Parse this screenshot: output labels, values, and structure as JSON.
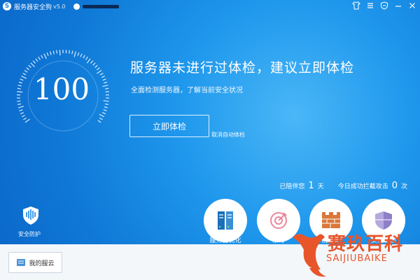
{
  "titlebar": {
    "logo_letter": "S",
    "title": "服务器安全狗",
    "version": "v5.0",
    "controls": {
      "skin": "shirt-icon",
      "menu": "menu-icon",
      "feedback": "shield-icon",
      "minimize": "minimize-icon",
      "close": "close-icon"
    }
  },
  "gauge": {
    "score": "100"
  },
  "main": {
    "headline": "服务器未进行过体检，建议立即体检",
    "subline": "全面检测服务器，了解当前安全状况",
    "primary_button": "立即体检",
    "cancel_link": "取消自动体检"
  },
  "stats": {
    "accompany_prefix": "已陪伴您",
    "accompany_days": "1",
    "accompany_unit": "天",
    "blocked_prefix": "今日成功拦截攻击",
    "blocked_count": "0",
    "blocked_unit": "次"
  },
  "protect": {
    "label": "安全防护",
    "icon": "shield-pulse-icon"
  },
  "tiles": [
    {
      "label": "服务器优化",
      "icon": "server-icon"
    },
    {
      "label": "杀毒",
      "icon": "target-icon"
    },
    {
      "label": "防火墙",
      "icon": "firewall-icon"
    },
    {
      "label": "安全加固",
      "icon": "shield-icon"
    }
  ],
  "bottom": {
    "cloud_button": "我的服云"
  },
  "watermark": {
    "brand": "赛玖百科",
    "brand_latin": "SAIJIUBAIKE"
  },
  "colors": {
    "accent": "#1b86e6",
    "brand": "#e8552b"
  }
}
